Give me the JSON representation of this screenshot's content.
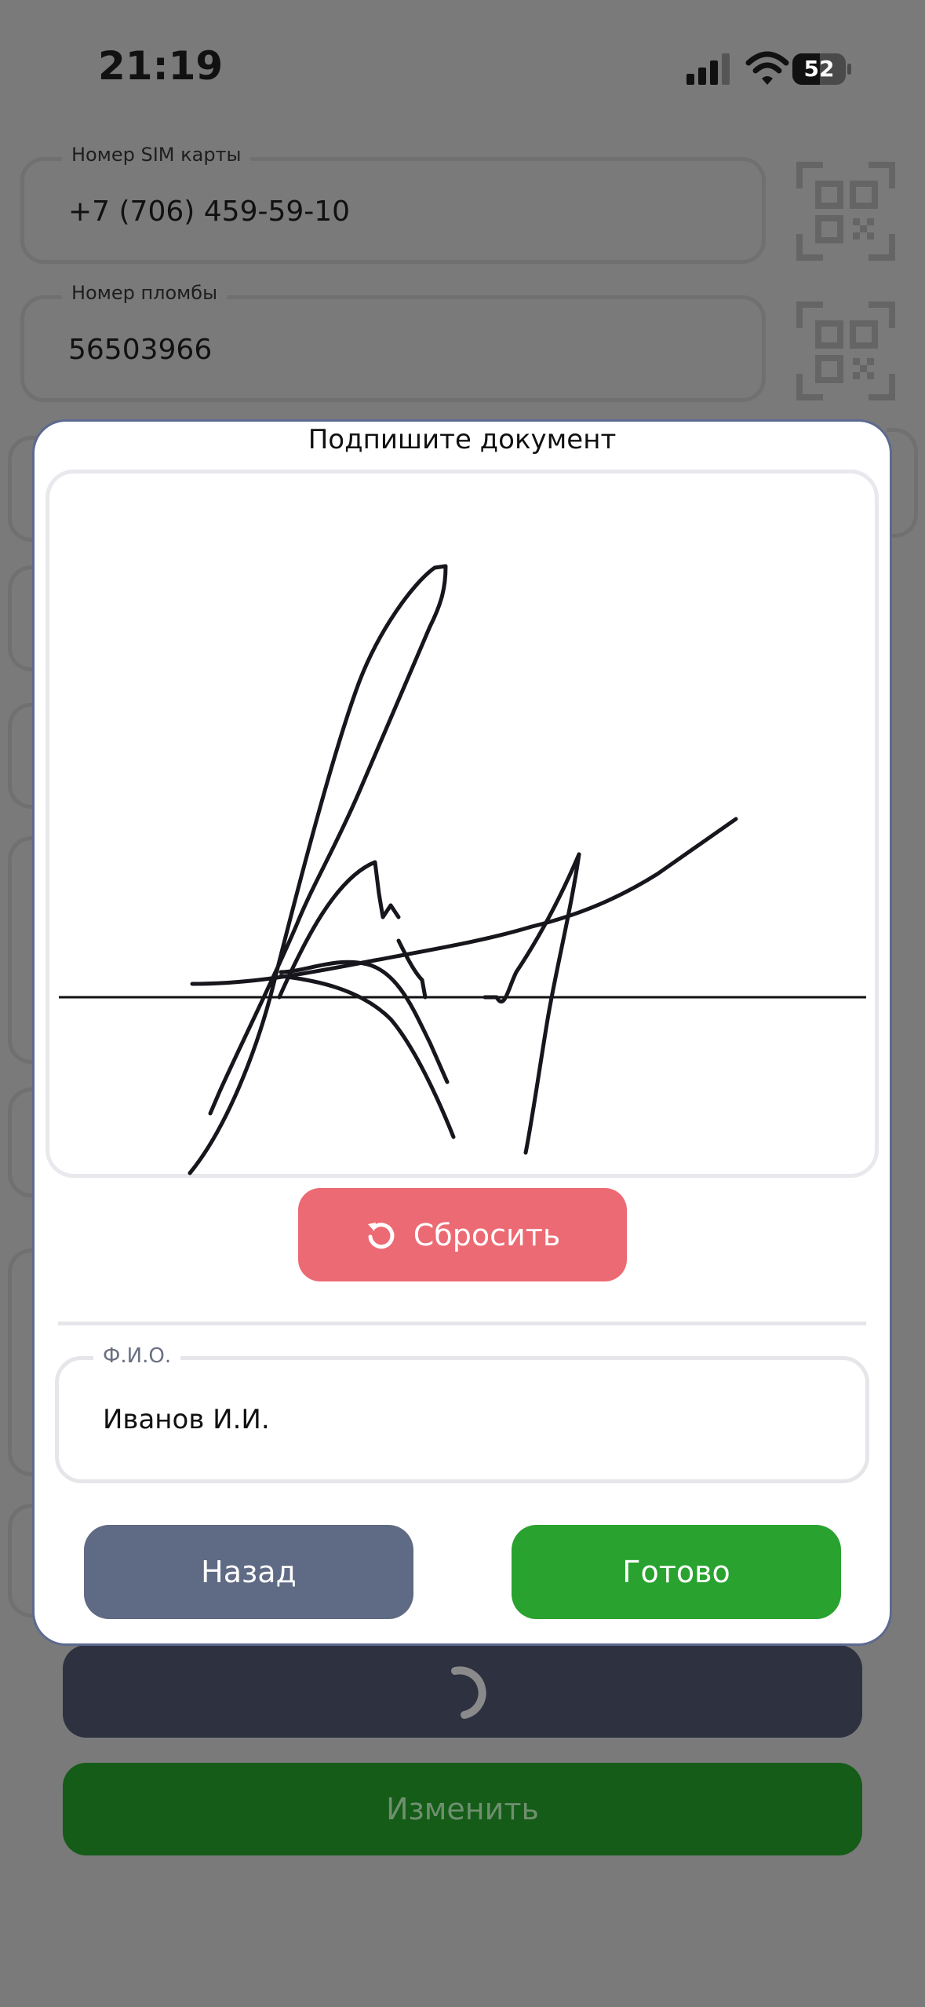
{
  "status_bar": {
    "time": "21:19",
    "battery_level": "52",
    "battery_fraction": 0.52,
    "icons": [
      "cellular-signal-icon",
      "wifi-icon",
      "battery-icon"
    ]
  },
  "form": {
    "sim_label": "Номер SIM карты",
    "sim_value": "+7 (706) 459-59-10",
    "seal_label": "Номер пломбы",
    "seal_value": "56503966",
    "edit_button": "Изменить",
    "scan_icon": "qr-code-icon"
  },
  "modal": {
    "title": "Подпишите документ",
    "reset_label": "Сбросить",
    "reset_icon": "rotate-ccw-icon",
    "fio_label": "Ф.И.О.",
    "fio_value": "Иванов И.И.",
    "back_label": "Назад",
    "done_label": "Готово"
  },
  "colors": {
    "reset": "#ec6a73",
    "done": "#29a22f",
    "back": "#5f6a84",
    "edit": "#145c17",
    "overlay": "#7a7a7a"
  }
}
